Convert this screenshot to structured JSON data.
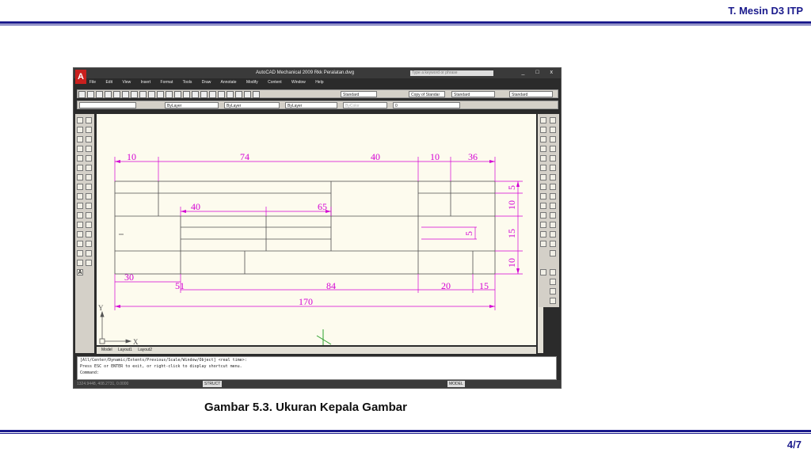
{
  "header": {
    "title": "T. Mesin D3 ITP"
  },
  "footer": {
    "page": "4/7"
  },
  "caption": "Gambar 5.3. Ukuran Kepala Gambar",
  "autocad": {
    "app_logo": "A",
    "window_title": "AutoCAD Mechanical 2009 Rkk Peralatan.dwg",
    "search_placeholder": "Type a keyword or phrase",
    "menu": [
      "File",
      "Edit",
      "View",
      "Insert",
      "Format",
      "Tools",
      "Draw",
      "Annotate",
      "Modify",
      "Content",
      "Window",
      "Help"
    ],
    "toolbar": {
      "text_style": "Standard",
      "dim_style": "Copy of Standar",
      "table_style": "Standard",
      "mleader_style": "Standard",
      "color": "ByLayer",
      "linetype": "ByLayer",
      "lineweight": "ByLayer",
      "plotstyle": "ByColor",
      "layer": "0"
    },
    "tabs": [
      "Model",
      "Layout1",
      "Layout2"
    ],
    "command_lines": [
      "[All/Center/Dynamic/Extents/Previous/Scale/Window/Object] <real time>:",
      "Press ESC or ENTER to exit, or right-click to display shortcut menu.",
      "Command:"
    ],
    "status": {
      "coordinates": "1324.9448, 408.2731, 0.0000",
      "struct": "STRUCT",
      "model": "MODEL"
    },
    "ucs": {
      "x": "X",
      "y": "Y"
    }
  },
  "drawing": {
    "dimensions_top": [
      "10",
      "74",
      "40",
      "10",
      "36"
    ],
    "dimensions_inner": [
      "40",
      "65"
    ],
    "dimensions_bottom_row1": [
      "30",
      "51",
      "84",
      "20",
      "15"
    ],
    "dimensions_total": "170",
    "dimensions_right": [
      "5",
      "10",
      "15",
      "10"
    ],
    "dimension_inner_right": "5",
    "colors": {
      "dimension": "#d400d4",
      "line": "#505050",
      "canvas": "#fdfbee"
    }
  }
}
